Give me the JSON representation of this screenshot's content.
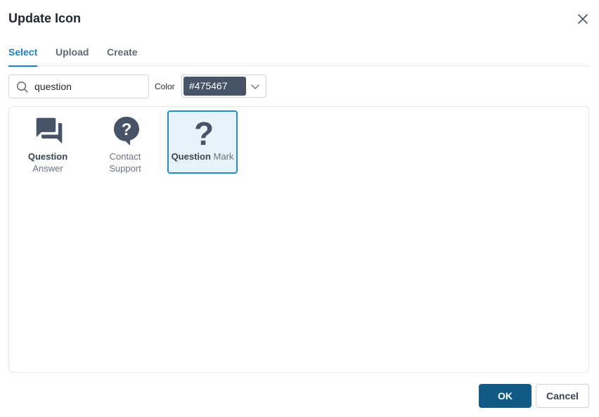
{
  "dialog": {
    "title": "Update Icon",
    "close_icon": "close-icon"
  },
  "tabs": [
    {
      "label": "Select",
      "active": true
    },
    {
      "label": "Upload",
      "active": false
    },
    {
      "label": "Create",
      "active": false
    }
  ],
  "search": {
    "value": "question",
    "placeholder": "",
    "icon": "search-icon"
  },
  "color": {
    "label": "Color",
    "value": "#475467",
    "icon": "chevron-down-icon"
  },
  "icons": [
    {
      "bold": "Question",
      "rest": "Answer",
      "icon": "question-answer-icon",
      "selected": false
    },
    {
      "bold": "",
      "rest": "Contact Support",
      "icon": "contact-support-icon",
      "selected": false
    },
    {
      "bold": "Question",
      "rest": "Mark",
      "icon": "question-mark-icon",
      "selected": true
    }
  ],
  "footer": {
    "ok_label": "OK",
    "cancel_label": "Cancel"
  },
  "colors": {
    "accent": "#1f7fc4",
    "primary_button": "#0f5a87",
    "icon_color": "#475467",
    "selected_bg": "#e7f2fb"
  }
}
